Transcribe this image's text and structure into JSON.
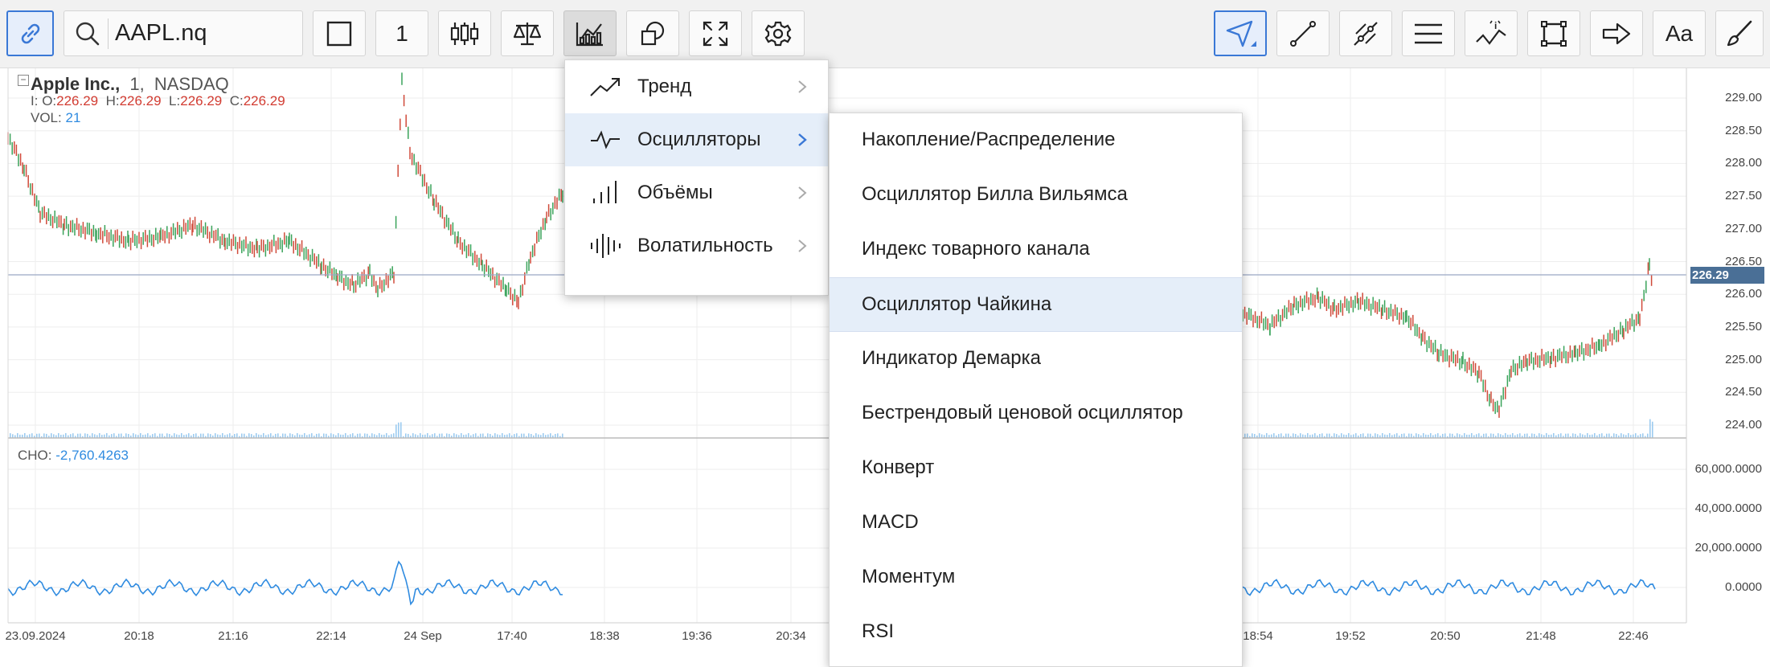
{
  "toolbar": {
    "symbol": "AAPL.nq",
    "interval": "1",
    "font_button": "Aa",
    "icons": [
      "link-icon",
      "search-icon",
      "square-icon",
      "candlestick-icon",
      "compare-icon",
      "indicators-icon",
      "shapes-icon",
      "fullscreen-icon",
      "gear-icon",
      "cursor-icon",
      "trend-line-icon",
      "multi-line-icon",
      "horizontal-lines-icon",
      "info-line-icon",
      "rectangle-icon",
      "arrow-icon",
      "text-icon",
      "brush-icon"
    ]
  },
  "legend": {
    "name": "Apple Inc.,",
    "interval": "1,",
    "exchange": "NASDAQ",
    "prefix": "I:",
    "o_label": "O:",
    "o": "226.29",
    "h_label": "H:",
    "h": "226.29",
    "l_label": "L:",
    "l": "226.29",
    "c_label": "C:",
    "c": "226.29",
    "vol_label": "VOL:",
    "vol": "21"
  },
  "oscillator": {
    "label": "CHO:",
    "value": "-2,760.4263"
  },
  "price_axis": [
    "229.00",
    "228.50",
    "228.00",
    "227.50",
    "227.00",
    "226.50",
    "226.00",
    "225.50",
    "225.00",
    "224.50",
    "224.00"
  ],
  "current_price": "226.29",
  "osc_axis": [
    "60,000.0000",
    "40,000.0000",
    "20,000.0000",
    "0.0000"
  ],
  "time_axis": [
    "23.09.2024",
    "20:18",
    "21:16",
    "22:14",
    "24 Sep",
    "17:40",
    "18:38",
    "19:36",
    "20:34",
    "18:54",
    "19:52",
    "20:50",
    "21:48",
    "22:46"
  ],
  "menu": {
    "categories": [
      {
        "label": "Тренд",
        "icon": "trend-icon"
      },
      {
        "label": "Осцилляторы",
        "icon": "oscillator-icon"
      },
      {
        "label": "Объёмы",
        "icon": "volume-icon"
      },
      {
        "label": "Волатильность",
        "icon": "volatility-icon"
      }
    ],
    "selected_category": "Осцилляторы",
    "oscillators": [
      "Накопление/Распределение",
      "Осциллятор Билла Вильямса",
      "Индекс товарного канала",
      "Осциллятор Чайкина",
      "Индикатор Демарка",
      "Бестрендовый ценовой осциллятор",
      "Конверт",
      "MACD",
      "Моментум",
      "RSI"
    ],
    "highlighted_oscillator": "Осциллятор Чайкина"
  },
  "colors": {
    "accent": "#3a78d6",
    "candle_up": "#3aa35a",
    "candle_down": "#d04a3a",
    "oscillator_line": "#2f8be0",
    "price_tag": "#4a6f96"
  }
}
